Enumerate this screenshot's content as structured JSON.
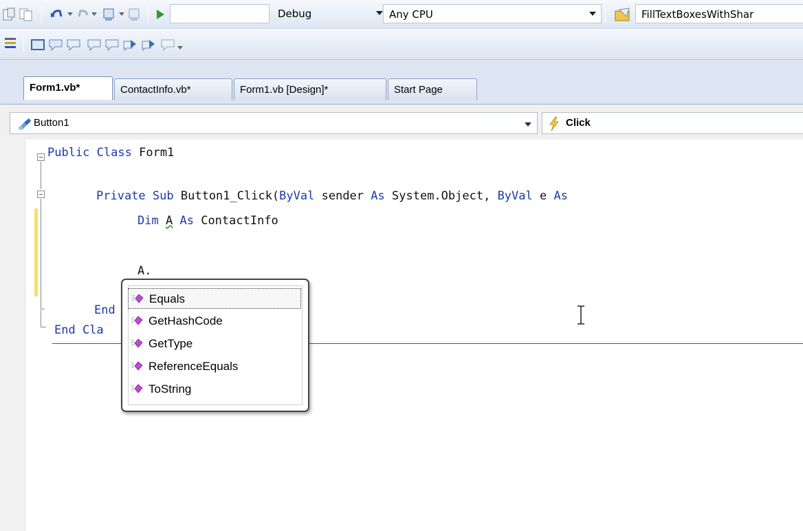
{
  "toolbar1": {
    "run_label": "Debug",
    "platform_label": "Any CPU",
    "project_label": "FillTextBoxesWithShar"
  },
  "tabs": [
    {
      "label": "Form1.vb*",
      "active": true
    },
    {
      "label": "ContactInfo.vb*",
      "active": false
    },
    {
      "label": "Form1.vb [Design]*",
      "active": false
    },
    {
      "label": "Start Page",
      "active": false
    }
  ],
  "memberbar": {
    "object_label": "Button1",
    "event_label": "Click"
  },
  "code": {
    "line1_kw1": "Public",
    "line1_kw2": "Class",
    "line1_rest": "Form1",
    "line2_kw1": "Private",
    "line2_kw2": "Sub",
    "line2_rest1": "Button1_Click(",
    "line2_kw3": "ByVal",
    "line2_rest2": "sender",
    "line2_kw4": "As",
    "line2_rest3": "System.Object,",
    "line2_kw5": "ByVal",
    "line2_rest4": "e",
    "line2_kw6": "As",
    "line3_kw1": "Dim",
    "line3_var": "A",
    "line3_kw2": "As",
    "line3_type": "ContactInfo",
    "line4_text": "A.",
    "line5_kw": "End",
    "line6_kw": "End Cla"
  },
  "intellisense": {
    "items": [
      "Equals",
      "GetHashCode",
      "GetType",
      "ReferenceEquals",
      "ToString"
    ],
    "selected_index": 0
  },
  "colors": {
    "keyword": "#1a3aa8",
    "change_bar": "#f3e06a",
    "method_icon": "#c04ad8"
  }
}
